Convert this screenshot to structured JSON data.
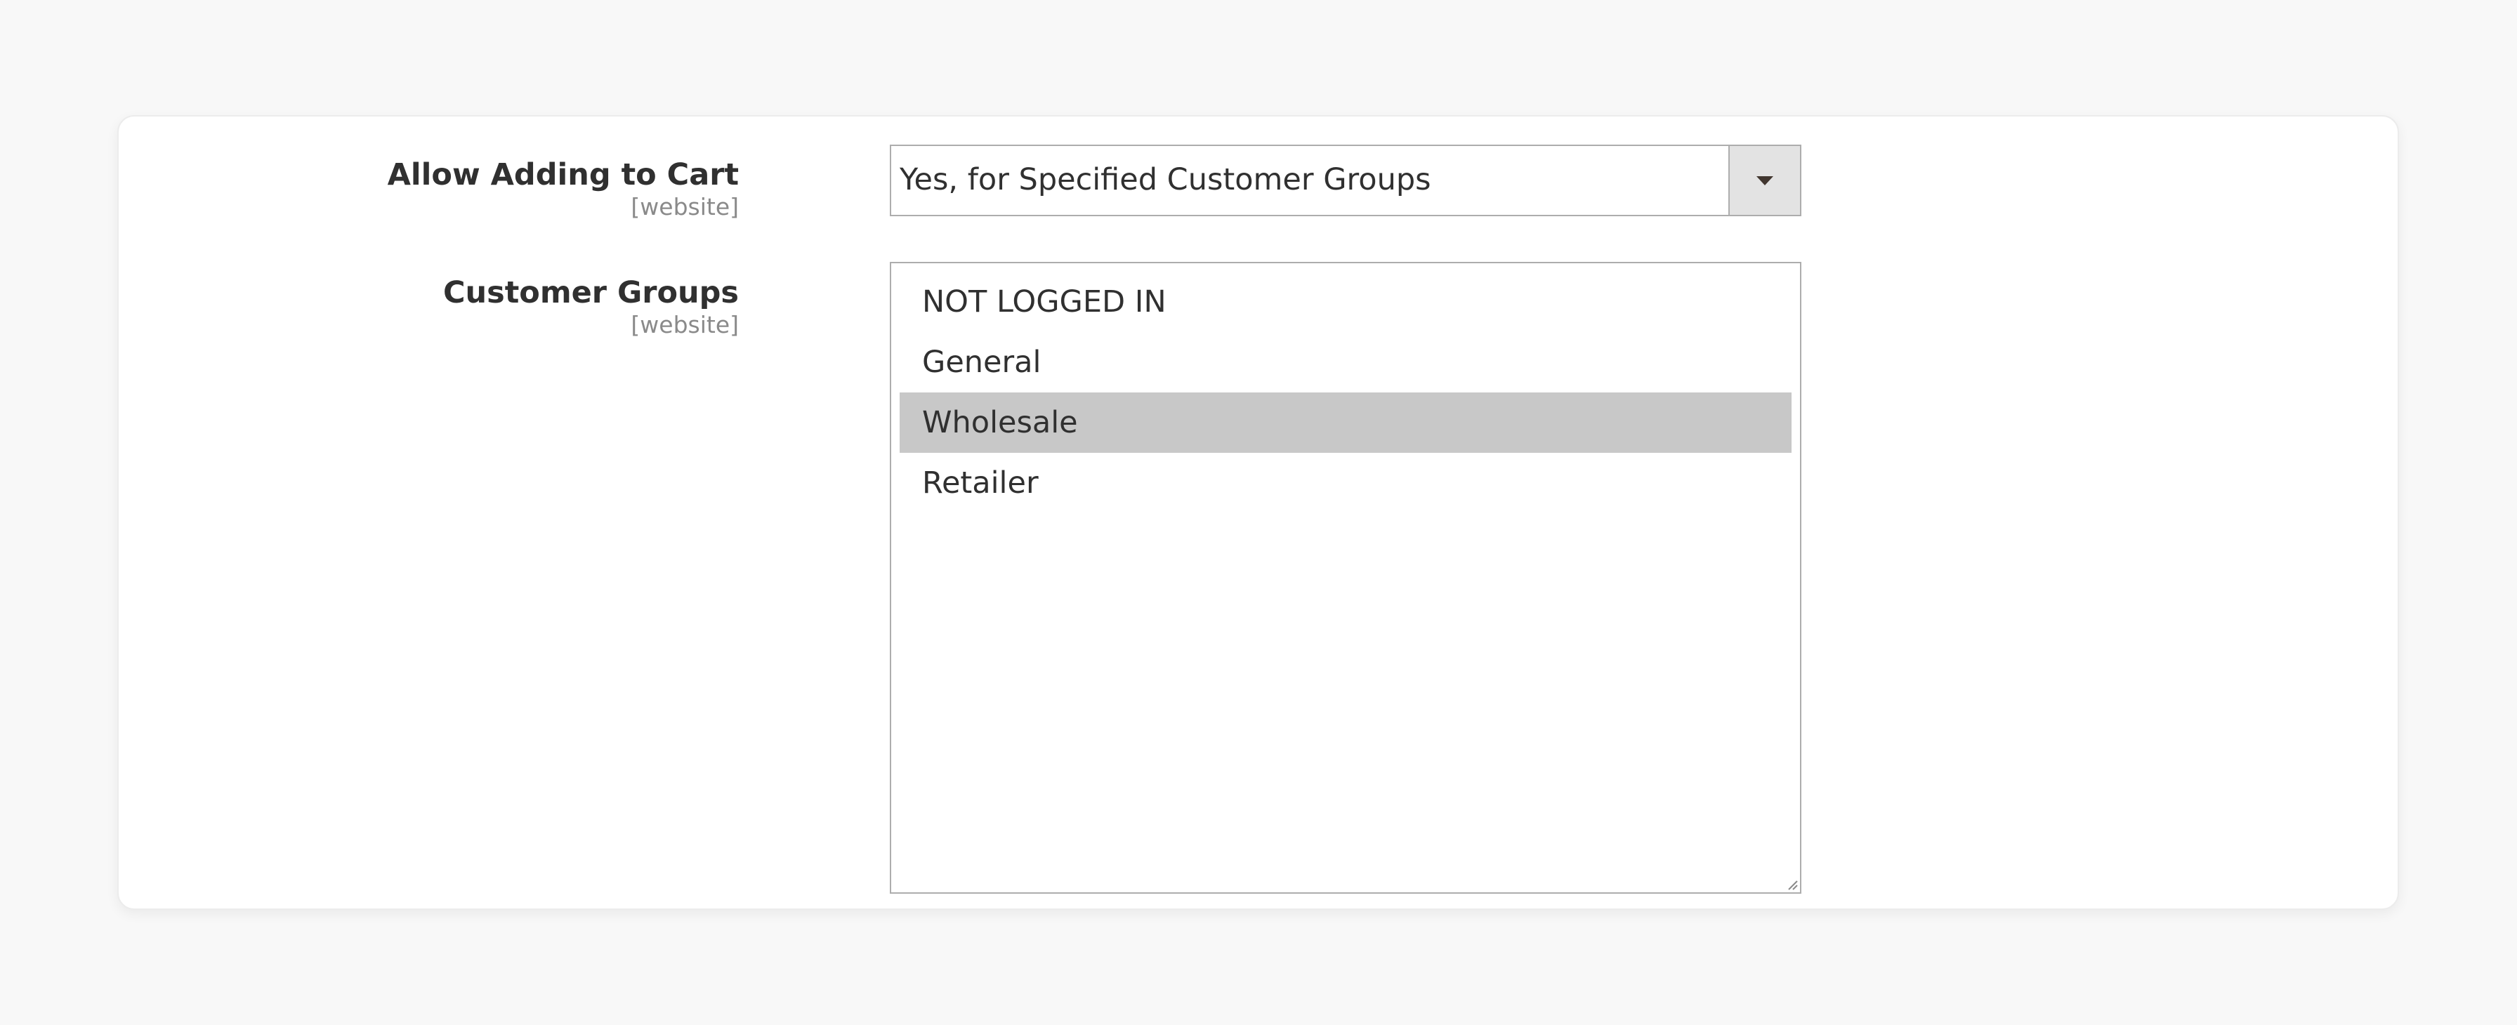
{
  "form": {
    "allow_adding_to_cart": {
      "label": "Allow Adding to Cart",
      "scope": "[website]",
      "selected_value": "Yes, for Specified Customer Groups"
    },
    "customer_groups": {
      "label": "Customer Groups",
      "scope": "[website]",
      "options": [
        {
          "label": "NOT LOGGED IN",
          "selected": false
        },
        {
          "label": "General",
          "selected": false
        },
        {
          "label": "Wholesale",
          "selected": true
        },
        {
          "label": "Retailer",
          "selected": false
        }
      ]
    }
  },
  "icons": {
    "dropdown": "chevron-down-icon",
    "resize": "resize-handle-icon"
  },
  "colors": {
    "page_background": "#f8f8f8",
    "card_background": "#ffffff",
    "selected_option": "#c8c8c8",
    "border": "#adadad",
    "label_text": "#303030",
    "scope_text": "#8a8a8a"
  }
}
